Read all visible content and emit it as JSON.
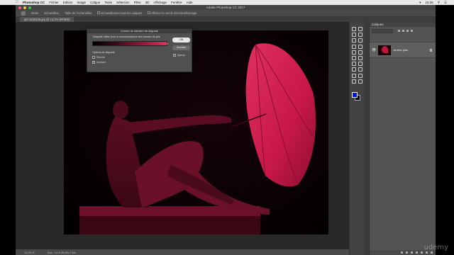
{
  "menubar": {
    "apple": "",
    "app": "Photoshop CC",
    "items": [
      "Fichier",
      "Edition",
      "Image",
      "Calque",
      "Texte",
      "Sélection",
      "Filtre",
      "3D",
      "Affichage",
      "Fenêtre",
      "Aide"
    ],
    "time": "15:26"
  },
  "window": {
    "title": "Adobe Photoshop CC 2017"
  },
  "options_bar": {
    "mode_label": "Mode",
    "sample_label": "Echantillon",
    "sample_value": "Taille de l'échantillon",
    "all_layers_label": "Echantillonner tous les calques",
    "show_ring_label": "Afficher le cercle d'échantillonnage"
  },
  "document": {
    "tab": "girl-1226156.jpg @ 13,3% (RVB/8)"
  },
  "status_bar": {
    "zoom": "13,33 %",
    "info": "Doc : 31,0 Mo/31,0 Mo"
  },
  "layers_panel": {
    "title": "Calques",
    "layer_name": "Arrière-plan"
  },
  "dialog": {
    "title": "Courbe de transfert de dégradé",
    "group_label": "Dégradé utilisé pour la correspondance des niveaux de gris",
    "options_label": "Options de dégradé",
    "dither_label": "Simuler",
    "dither_checked": false,
    "reverse_label": "Inverser",
    "reverse_checked": true,
    "ok_label": "OK",
    "cancel_label": "Annuler",
    "preview_label": "Aperçu",
    "preview_checked": true,
    "gradient_colors": [
      "#000000",
      "#a0163f",
      "#e0305e"
    ]
  },
  "watermark": "udemy",
  "colors": {
    "foreground": "#0010f0",
    "background": "#000000",
    "accent": "#c8184a"
  }
}
